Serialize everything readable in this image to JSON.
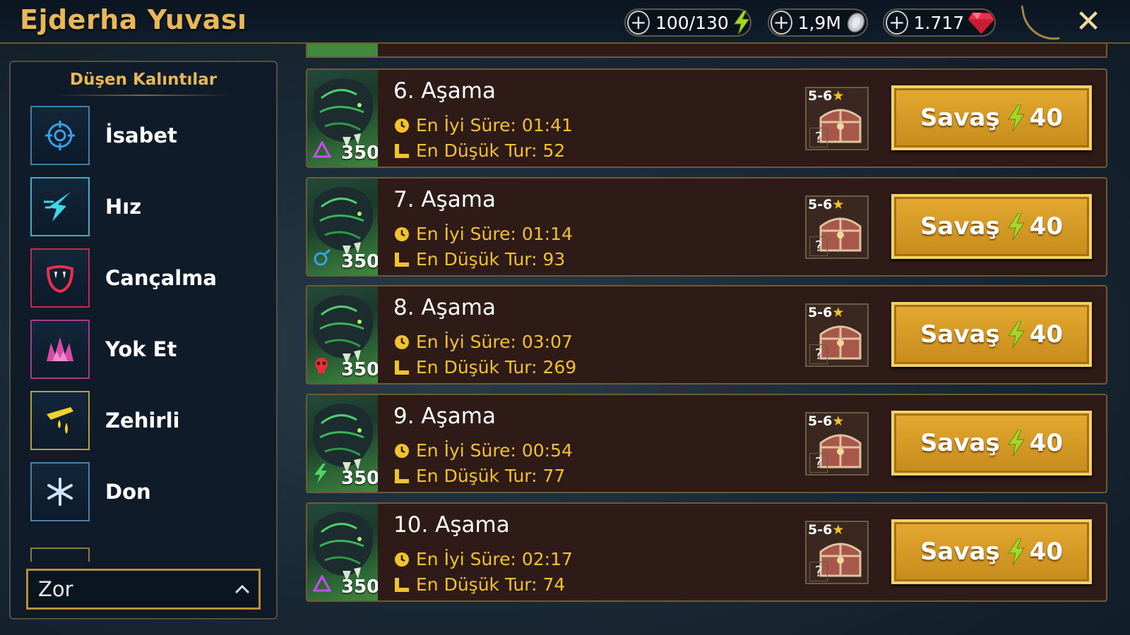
{
  "header": {
    "title": "Ejderha Yuvası",
    "resources": [
      {
        "value": "100/130",
        "icon": "energy-icon"
      },
      {
        "value": "1,9M",
        "icon": "silver-icon"
      },
      {
        "value": "1.717",
        "icon": "gem-icon"
      }
    ],
    "plus": "+",
    "close": "✕"
  },
  "left_panel": {
    "title": "Düşen Kalıntılar",
    "relics": [
      {
        "label": "İsabet",
        "icon": "accuracy-icon"
      },
      {
        "label": "Hız",
        "icon": "speed-icon"
      },
      {
        "label": "Cançalma",
        "icon": "lifesteal-icon"
      },
      {
        "label": "Yok Et",
        "icon": "destroy-icon"
      },
      {
        "label": "Zehirli",
        "icon": "poison-icon"
      },
      {
        "label": "Don",
        "icon": "frost-icon"
      }
    ],
    "difficulty": "Zor"
  },
  "stages": [
    {
      "name": "6. Aşama",
      "best_time": "En İyi Süre: 01:41",
      "min_turn": "En Düşük Tur: 52",
      "hp": "350",
      "affinity": "magic",
      "reward_stars": "5-6",
      "battle_label": "Savaş",
      "battle_cost": "40"
    },
    {
      "name": "7. Aşama",
      "best_time": "En İyi Süre: 01:14",
      "min_turn": "En Düşük Tur: 93",
      "hp": "350",
      "affinity": "spirit",
      "reward_stars": "5-6",
      "battle_label": "Savaş",
      "battle_cost": "40"
    },
    {
      "name": "8. Aşama",
      "best_time": "En İyi Süre: 03:07",
      "min_turn": "En Düşük Tur: 269",
      "hp": "350",
      "affinity": "force",
      "reward_stars": "5-6",
      "battle_label": "Savaş",
      "battle_cost": "40"
    },
    {
      "name": "9. Aşama",
      "best_time": "En İyi Süre: 00:54",
      "min_turn": "En Düşük Tur: 77",
      "hp": "350",
      "affinity": "void",
      "reward_stars": "5-6",
      "battle_label": "Savaş",
      "battle_cost": "40"
    },
    {
      "name": "10. Aşama",
      "best_time": "En İyi Süre: 02:17",
      "min_turn": "En Düşük Tur: 74",
      "hp": "350",
      "affinity": "magic",
      "reward_stars": "5-6",
      "battle_label": "Savaş",
      "battle_cost": "40"
    }
  ],
  "reward_unknown": "?",
  "colors": {
    "gold": "#e8b75a",
    "stat_yellow": "#f0c230",
    "battle_btn": "#d69a22",
    "row_bg": "#2e1a16"
  }
}
